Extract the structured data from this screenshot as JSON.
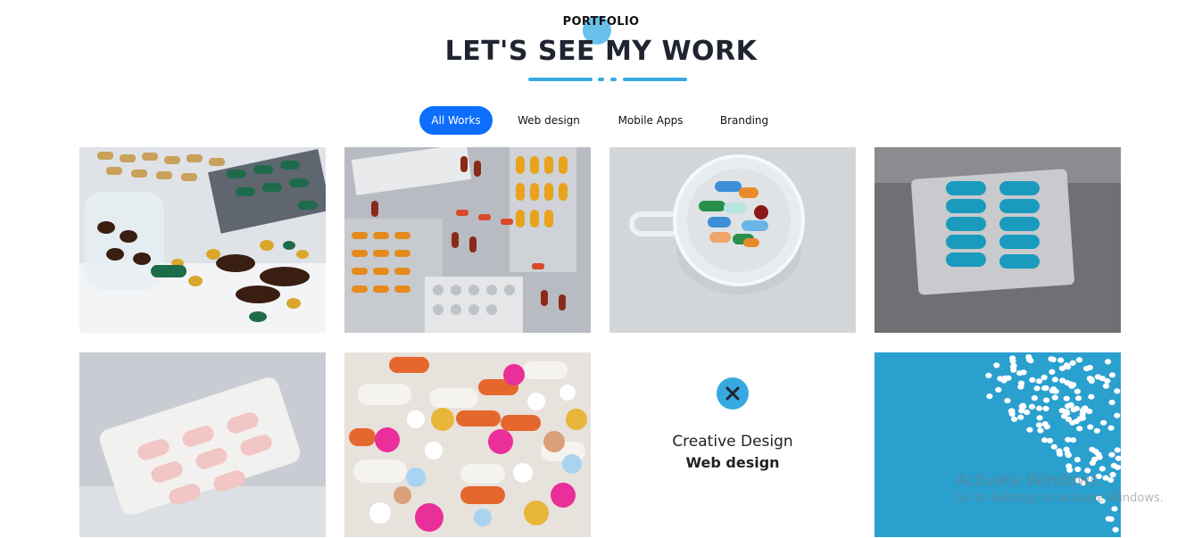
{
  "section": {
    "eyebrow": "PORTFOLIO",
    "title": "LET'S SEE MY WORK"
  },
  "filters": [
    {
      "label": "All Works",
      "active": true
    },
    {
      "label": "Web design",
      "active": false
    },
    {
      "label": "Mobile Apps",
      "active": false
    },
    {
      "label": "Branding",
      "active": false
    }
  ],
  "portfolio": {
    "items": [
      {
        "subject": "pill-jar-capsules"
      },
      {
        "subject": "blister-packs-pile"
      },
      {
        "subject": "pills-in-glass-cup"
      },
      {
        "subject": "blue-capsule-blister"
      },
      {
        "subject": "white-pink-blister"
      },
      {
        "subject": "colorful-pills-pile"
      },
      {
        "subject": "hover-overlay",
        "overlay": {
          "title": "Creative Design",
          "category": "Web design"
        }
      },
      {
        "subject": "white-pills-on-blue"
      }
    ]
  },
  "colors": {
    "accent": "#36a9e1",
    "active_filter": "#0d6efd",
    "title": "#1f2430"
  },
  "watermark": {
    "line1": "Activate Windows",
    "line2": "Go to Settings to activate Windows."
  }
}
